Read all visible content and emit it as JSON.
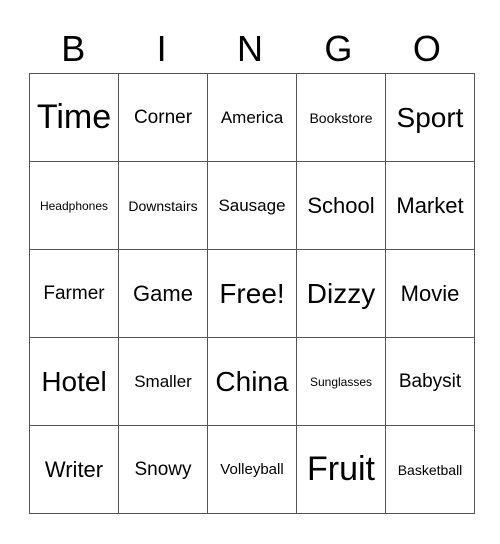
{
  "header": [
    "B",
    "I",
    "N",
    "G",
    "O"
  ],
  "rows": [
    [
      "Time",
      "Corner",
      "America",
      "Bookstore",
      "Sport"
    ],
    [
      "Headphones",
      "Downstairs",
      "Sausage",
      "School",
      "Market"
    ],
    [
      "Farmer",
      "Game",
      "Free!",
      "Dizzy",
      "Movie"
    ],
    [
      "Hotel",
      "Smaller",
      "China",
      "Sunglasses",
      "Babysit"
    ],
    [
      "Writer",
      "Snowy",
      "Volleyball",
      "Fruit",
      "Basketball"
    ]
  ]
}
